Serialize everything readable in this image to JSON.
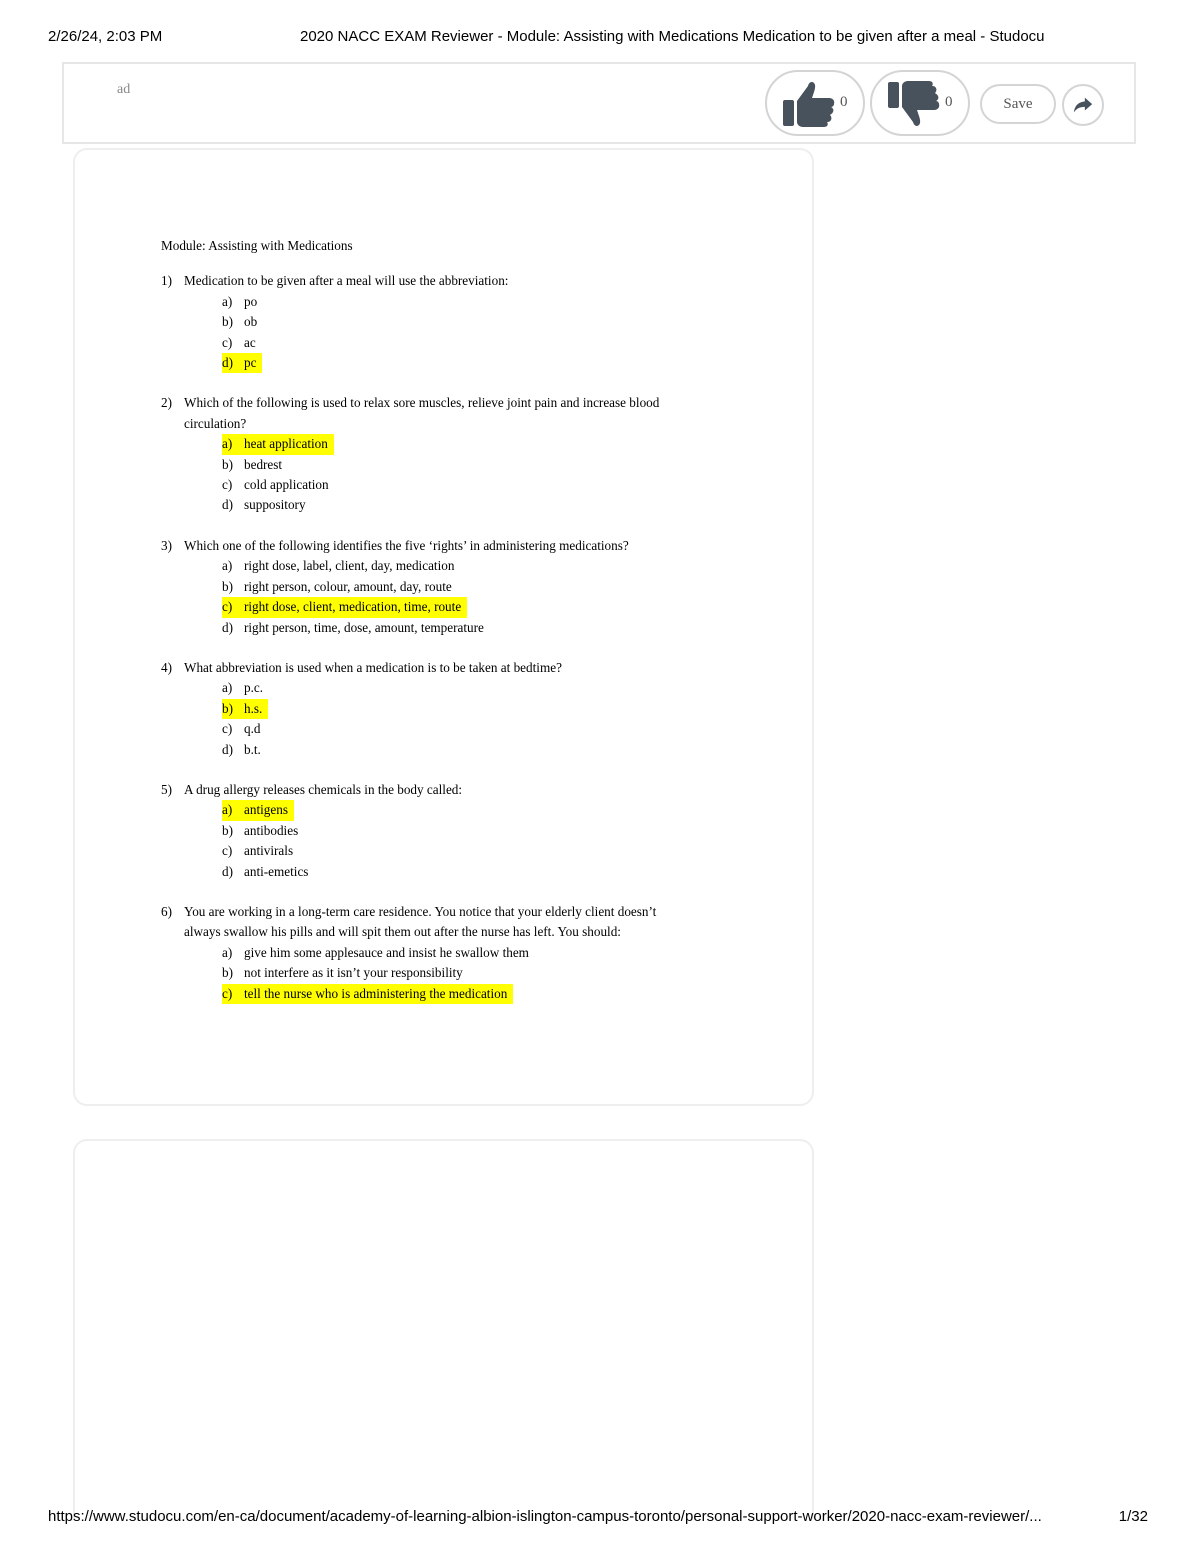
{
  "print_header": {
    "datetime": "2/26/24, 2:03 PM",
    "title": "2020 NACC EXAM Reviewer - Module: Assisting with Medications Medication to be given after a meal - Studocu"
  },
  "toolbar": {
    "ad_label": "ad",
    "like_count": "0",
    "dislike_count": "0",
    "save_label": "Save",
    "like_icon": "thumbs-up-icon",
    "dislike_icon": "thumbs-down-icon",
    "share_icon": "share-arrow-icon",
    "icon_color": "#48525c"
  },
  "document": {
    "module_title": "Module: Assisting with Medications",
    "highlight_color": "#ffff00",
    "questions": [
      {
        "number": "1)",
        "text_lines": [
          "Medication to be given after a meal will use the abbreviation:"
        ],
        "options": [
          {
            "letter": "a)",
            "text": "po",
            "answer": false
          },
          {
            "letter": "b)",
            "text": "ob",
            "answer": false
          },
          {
            "letter": "c)",
            "text": "ac",
            "answer": false
          },
          {
            "letter": "d)",
            "text": "pc",
            "answer": true
          }
        ]
      },
      {
        "number": "2)",
        "text_lines": [
          "Which of the following is used to relax sore muscles, relieve joint pain and increase blood",
          "circulation?"
        ],
        "options": [
          {
            "letter": "a)",
            "text": "heat application",
            "answer": true
          },
          {
            "letter": "b)",
            "text": "bedrest",
            "answer": false
          },
          {
            "letter": "c)",
            "text": "cold application",
            "answer": false
          },
          {
            "letter": "d)",
            "text": "suppository",
            "answer": false
          }
        ]
      },
      {
        "number": "3)",
        "text_lines": [
          "Which one of the following identifies the five ‘rights’ in administering medications?"
        ],
        "options": [
          {
            "letter": "a)",
            "text": "right dose, label, client, day, medication",
            "answer": false
          },
          {
            "letter": "b)",
            "text": "right person, colour, amount, day, route",
            "answer": false
          },
          {
            "letter": "c)",
            "text": "right dose, client, medication, time, route",
            "answer": true
          },
          {
            "letter": "d)",
            "text": "right person, time, dose, amount, temperature",
            "answer": false
          }
        ]
      },
      {
        "number": "4)",
        "text_lines": [
          "What abbreviation is used when a medication is to be taken at bedtime?"
        ],
        "options": [
          {
            "letter": "a)",
            "text": "p.c.",
            "answer": false
          },
          {
            "letter": "b)",
            "text": "h.s.",
            "answer": true
          },
          {
            "letter": "c)",
            "text": "q.d",
            "answer": false
          },
          {
            "letter": "d)",
            "text": "b.t.",
            "answer": false
          }
        ]
      },
      {
        "number": "5)",
        "text_lines": [
          "A drug allergy releases chemicals in the body called:"
        ],
        "options": [
          {
            "letter": "a)",
            "text": "antigens",
            "answer": true
          },
          {
            "letter": "b)",
            "text": "antibodies",
            "answer": false
          },
          {
            "letter": "c)",
            "text": "antivirals",
            "answer": false
          },
          {
            "letter": "d)",
            "text": "anti-emetics",
            "answer": false
          }
        ]
      },
      {
        "number": "6)",
        "text_lines": [
          "You are working in a long-term care residence. You notice that your elderly client doesn’t",
          "always swallow his pills and will spit them out after the nurse has left. You should:"
        ],
        "options": [
          {
            "letter": "a)",
            "text": "give him some applesauce and insist he swallow them",
            "answer": false
          },
          {
            "letter": "b)",
            "text": "not interfere as it isn’t your responsibility",
            "answer": false
          },
          {
            "letter": "c)",
            "text": "tell the nurse who is administering the medication",
            "answer": true
          }
        ]
      }
    ]
  },
  "print_footer": {
    "url": "https://www.studocu.com/en-ca/document/academy-of-learning-albion-islington-campus-toronto/personal-support-worker/2020-nacc-exam-reviewer/...",
    "page": "1/32"
  }
}
